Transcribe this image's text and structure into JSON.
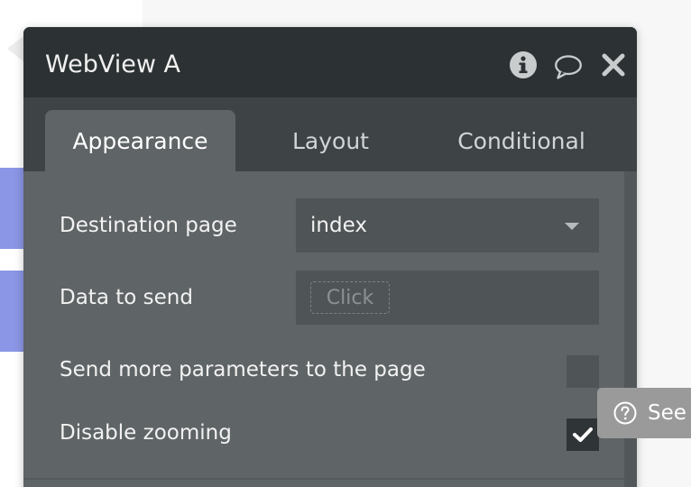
{
  "panel": {
    "title": "WebView A",
    "header_icons": [
      "info-icon",
      "comment-icon",
      "close-icon"
    ]
  },
  "tabs": [
    {
      "label": "Appearance",
      "active": true
    },
    {
      "label": "Layout",
      "active": false
    },
    {
      "label": "Conditional",
      "active": false
    }
  ],
  "properties": {
    "destination_page": {
      "label": "Destination page",
      "value": "index"
    },
    "data_to_send": {
      "label": "Data to send",
      "button": "Click"
    },
    "send_more_parameters": {
      "label": "Send more parameters to the page",
      "checked": false
    },
    "disable_zooming": {
      "label": "Disable zooming",
      "checked": true
    }
  },
  "help_button": {
    "label": "See",
    "icon": "question-circle-icon"
  },
  "colors": {
    "header_bg": "#2c3133",
    "tab_bar_bg": "#3e4345",
    "panel_bg": "#5f6466",
    "field_bg": "#4f5456",
    "canvas_accent": "#8b96e6"
  }
}
